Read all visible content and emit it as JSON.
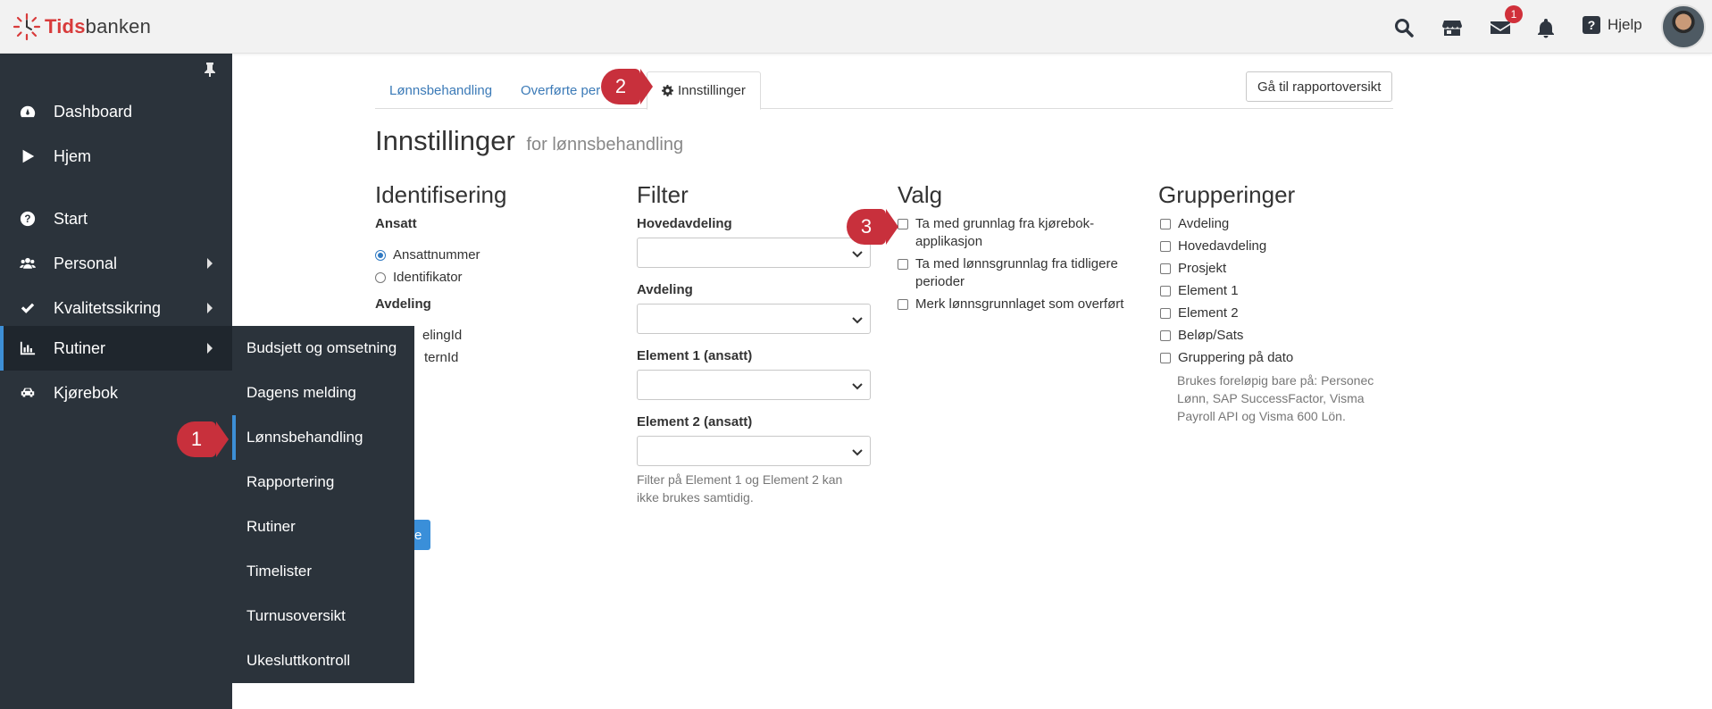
{
  "app": {
    "logo_part1": "Tids",
    "logo_part2": "banken"
  },
  "topbar": {
    "mail_badge": "1",
    "help_label": "Hjelp"
  },
  "sidebar": {
    "items": [
      {
        "label": "Dashboard"
      },
      {
        "label": "Hjem"
      },
      {
        "label": "Start"
      },
      {
        "label": "Personal"
      },
      {
        "label": "Kvalitetssikring"
      },
      {
        "label": "Rutiner"
      },
      {
        "label": "Kjørebok"
      }
    ]
  },
  "submenu": {
    "items": [
      {
        "label": "Budsjett og omsetning"
      },
      {
        "label": "Dagens melding"
      },
      {
        "label": "Lønnsbehandling"
      },
      {
        "label": "Rapportering"
      },
      {
        "label": "Rutiner"
      },
      {
        "label": "Timelister"
      },
      {
        "label": "Turnusoversikt"
      },
      {
        "label": "Ukesluttkontroll"
      }
    ]
  },
  "markers": {
    "m1": "1",
    "m2": "2",
    "m3": "3"
  },
  "tabs": {
    "t1": "Lønnsbehandling",
    "t2": "Overførte per",
    "t3": "Innstillinger",
    "report_button": "Gå til rapportoversikt"
  },
  "page": {
    "title": "Innstillinger",
    "subtitle": "for lønnsbehandling"
  },
  "identifisering": {
    "title": "Identifisering",
    "ansatt_label": "Ansatt",
    "radio1": "Ansattnummer",
    "radio2": "Identifikator",
    "avdeling_label": "Avdeling",
    "partial1": "elingId",
    "partial2": "ternId",
    "save_partial": "e"
  },
  "filter": {
    "title": "Filter",
    "hovedavdeling": "Hovedavdeling",
    "avdeling": "Avdeling",
    "element1": "Element 1 (ansatt)",
    "element2": "Element 2 (ansatt)",
    "help_line1": "Filter på Element 1 og Element 2 kan",
    "help_line2": "ikke brukes samtidig."
  },
  "valg": {
    "title": "Valg",
    "opt1_line1": "Ta med grunnlag fra kjørebok-",
    "opt1_line2": "applikasjon",
    "opt2_line1": "Ta med lønnsgrunnlag fra tidligere",
    "opt2_line2": "perioder",
    "opt3": "Merk lønnsgrunnlaget som overført"
  },
  "grupperinger": {
    "title": "Grupperinger",
    "items": [
      "Avdeling",
      "Hovedavdeling",
      "Prosjekt",
      "Element 1",
      "Element 2",
      "Beløp/Sats",
      "Gruppering på dato"
    ],
    "note_line1": "Brukes foreløpig bare på: Personec",
    "note_line2": "Lønn, SAP SuccessFactor, Visma",
    "note_line3": "Payroll API og Visma 600 Lön."
  }
}
